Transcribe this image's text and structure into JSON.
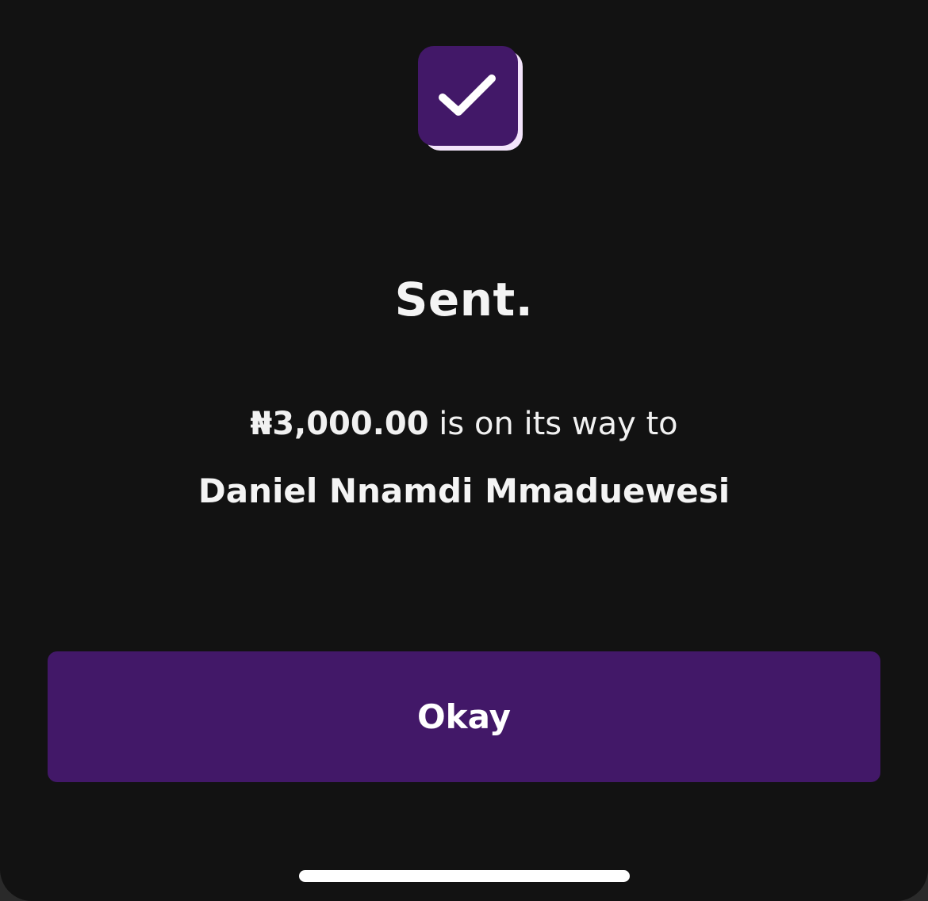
{
  "confirmation": {
    "title": "Sent.",
    "amount": "₦3,000.00",
    "message_suffix": "is on its way to",
    "recipient_name": "Daniel Nnamdi Mmaduewesi"
  },
  "actions": {
    "okay_label": "Okay"
  },
  "icons": {
    "success": "checkmark-icon"
  },
  "colors": {
    "background": "#121212",
    "accent": "#421868",
    "accent_shadow": "#f3e4fb",
    "text": "#ffffff"
  }
}
